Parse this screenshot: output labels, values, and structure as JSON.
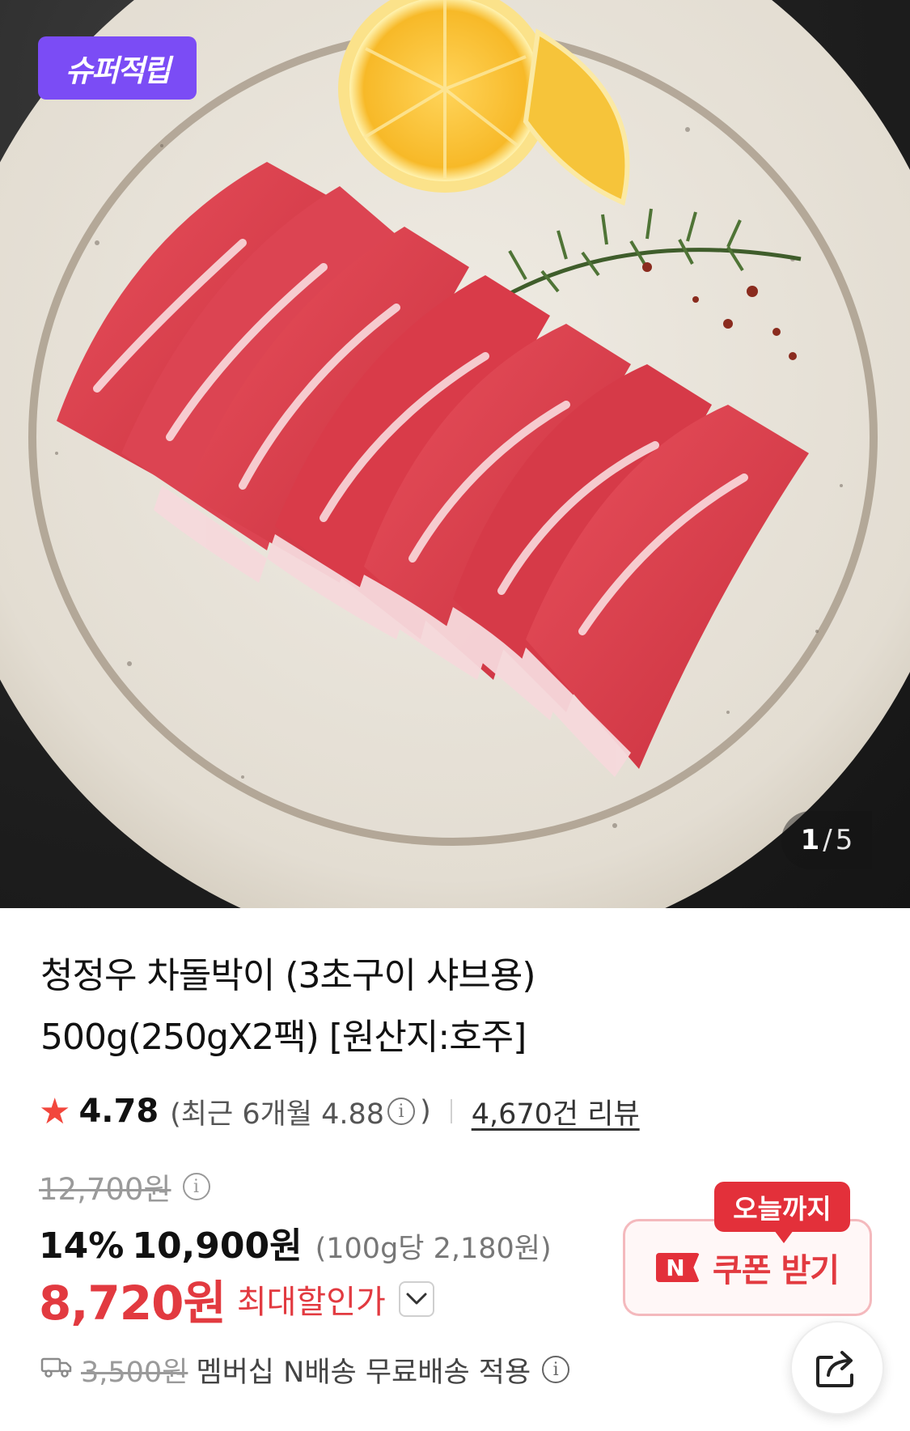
{
  "image": {
    "badge": "슈퍼적립",
    "counter_current": "1",
    "counter_sep": "/",
    "counter_total": "5"
  },
  "product": {
    "title_line1": "청정우 차돌박이 (3초구이 샤브용)",
    "title_line2": "500g(250gX2팩) [원산지:호주]"
  },
  "rating": {
    "value": "4.78",
    "recent_text": "(최근 6개월 4.88",
    "recent_close": ")",
    "reviews": "4,670건 리뷰"
  },
  "price": {
    "original": "12,700원",
    "discount_pct": "14%",
    "sale": "10,900원",
    "unit_price": "(100g당 2,180원)",
    "max_discount_price": "8,720원",
    "max_discount_label": "최대할인가"
  },
  "coupon": {
    "tag": "오늘까지",
    "brand_letter": "N",
    "label": "쿠폰 받기"
  },
  "shipping": {
    "original_fee": "3,500원",
    "text": "멤버십 N배송 무료배송 적용"
  },
  "colors": {
    "accent_red": "#e23a40",
    "badge_purple": "#7b4cf5"
  }
}
